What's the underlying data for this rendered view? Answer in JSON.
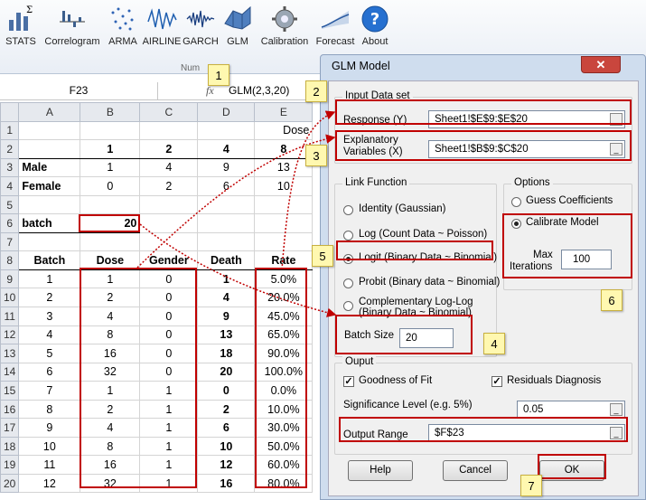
{
  "ribbon": {
    "buttons": [
      {
        "label": "STATS",
        "icon": "sigma-chart-icon"
      },
      {
        "label": "Correlogram",
        "icon": "correlogram-icon"
      },
      {
        "label": "ARMA",
        "icon": "arma-icon"
      },
      {
        "label": "AIRLINE",
        "icon": "airline-icon"
      },
      {
        "label": "GARCH",
        "icon": "garch-icon"
      },
      {
        "label": "GLM",
        "icon": "glm-surface-icon"
      },
      {
        "label": "Calibration",
        "icon": "calibration-gear-icon"
      },
      {
        "label": "Forecast",
        "icon": "forecast-icon"
      },
      {
        "label": "About",
        "icon": "help-icon"
      }
    ],
    "group_label": "Num"
  },
  "formula_bar": {
    "name_box": "F23",
    "fx": "fx",
    "formula": "GLM(2,3,20)"
  },
  "sheet": {
    "columns": [
      "A",
      "B",
      "C",
      "D",
      "E"
    ],
    "rows": [
      {
        "n": "1",
        "cells": [
          "",
          "",
          "",
          "",
          "Dose"
        ]
      },
      {
        "n": "2",
        "cells": [
          "",
          "1",
          "2",
          "4",
          "8"
        ]
      },
      {
        "n": "3",
        "cells": [
          "Male",
          "1",
          "4",
          "9",
          "13"
        ]
      },
      {
        "n": "4",
        "cells": [
          "Female",
          "0",
          "2",
          "6",
          "10"
        ]
      },
      {
        "n": "5",
        "cells": [
          "",
          "",
          "",
          "",
          ""
        ]
      },
      {
        "n": "6",
        "cells": [
          "batch",
          "20",
          "",
          "",
          ""
        ]
      },
      {
        "n": "7",
        "cells": [
          "",
          "",
          "",
          "",
          ""
        ]
      },
      {
        "n": "8",
        "cells": [
          "Batch",
          "Dose",
          "Gender",
          "Death",
          "Rate"
        ]
      },
      {
        "n": "9",
        "cells": [
          "1",
          "1",
          "0",
          "1",
          "5.0%"
        ]
      },
      {
        "n": "10",
        "cells": [
          "2",
          "2",
          "0",
          "4",
          "20.0%"
        ]
      },
      {
        "n": "11",
        "cells": [
          "3",
          "4",
          "0",
          "9",
          "45.0%"
        ]
      },
      {
        "n": "12",
        "cells": [
          "4",
          "8",
          "0",
          "13",
          "65.0%"
        ]
      },
      {
        "n": "13",
        "cells": [
          "5",
          "16",
          "0",
          "18",
          "90.0%"
        ]
      },
      {
        "n": "14",
        "cells": [
          "6",
          "32",
          "0",
          "20",
          "100.0%"
        ]
      },
      {
        "n": "15",
        "cells": [
          "7",
          "1",
          "1",
          "0",
          "0.0%"
        ]
      },
      {
        "n": "16",
        "cells": [
          "8",
          "2",
          "1",
          "2",
          "10.0%"
        ]
      },
      {
        "n": "17",
        "cells": [
          "9",
          "4",
          "1",
          "6",
          "30.0%"
        ]
      },
      {
        "n": "18",
        "cells": [
          "10",
          "8",
          "1",
          "10",
          "50.0%"
        ]
      },
      {
        "n": "19",
        "cells": [
          "11",
          "16",
          "1",
          "12",
          "60.0%"
        ]
      },
      {
        "n": "20",
        "cells": [
          "12",
          "32",
          "1",
          "16",
          "80.0%"
        ]
      }
    ]
  },
  "dialog": {
    "title": "GLM Model",
    "close": "✕",
    "input_group": "Input Data set",
    "response_label": "Response (Y)",
    "response_value": "Sheet1!$E$9:$E$20",
    "explanatory_label_1": "Explanatory",
    "explanatory_label_2": "Variables (X)",
    "explanatory_value": "Sheet1!$B$9:$C$20",
    "range_btn": "_",
    "link_group": "Link Function",
    "link_options": [
      "Identity (Gaussian)",
      "Log (Count Data ~ Poisson)",
      "Logit (Binary Data ~ Binomial)",
      "Probit (Binary data ~ Binomial)",
      "Complementary Log-Log",
      "(Binary Data ~ Binomial)"
    ],
    "options_group": "Options",
    "guess": "Guess Coefficients",
    "calibrate": "Calibrate Model",
    "max_iter_1": "Max",
    "max_iter_2": "Iterations",
    "max_iter_value": "100",
    "batch_label": "Batch Size",
    "batch_value": "20",
    "output_group": "Ouput",
    "goodness": "Goodness of Fit",
    "residuals": "Residuals Diagnosis",
    "check": "✓",
    "sig_label": "Significance Level (e.g. 5%)",
    "sig_value": "0.05",
    "output_label": "Output Range",
    "output_value": "$F$23",
    "help": "Help",
    "cancel": "Cancel",
    "ok": "OK"
  },
  "callouts": [
    "1",
    "2",
    "3",
    "4",
    "5",
    "6",
    "7"
  ],
  "colors": {
    "highlight": "#c00000",
    "callout_bg": "#fff8b0",
    "dialog_frame": "#cfddee"
  }
}
